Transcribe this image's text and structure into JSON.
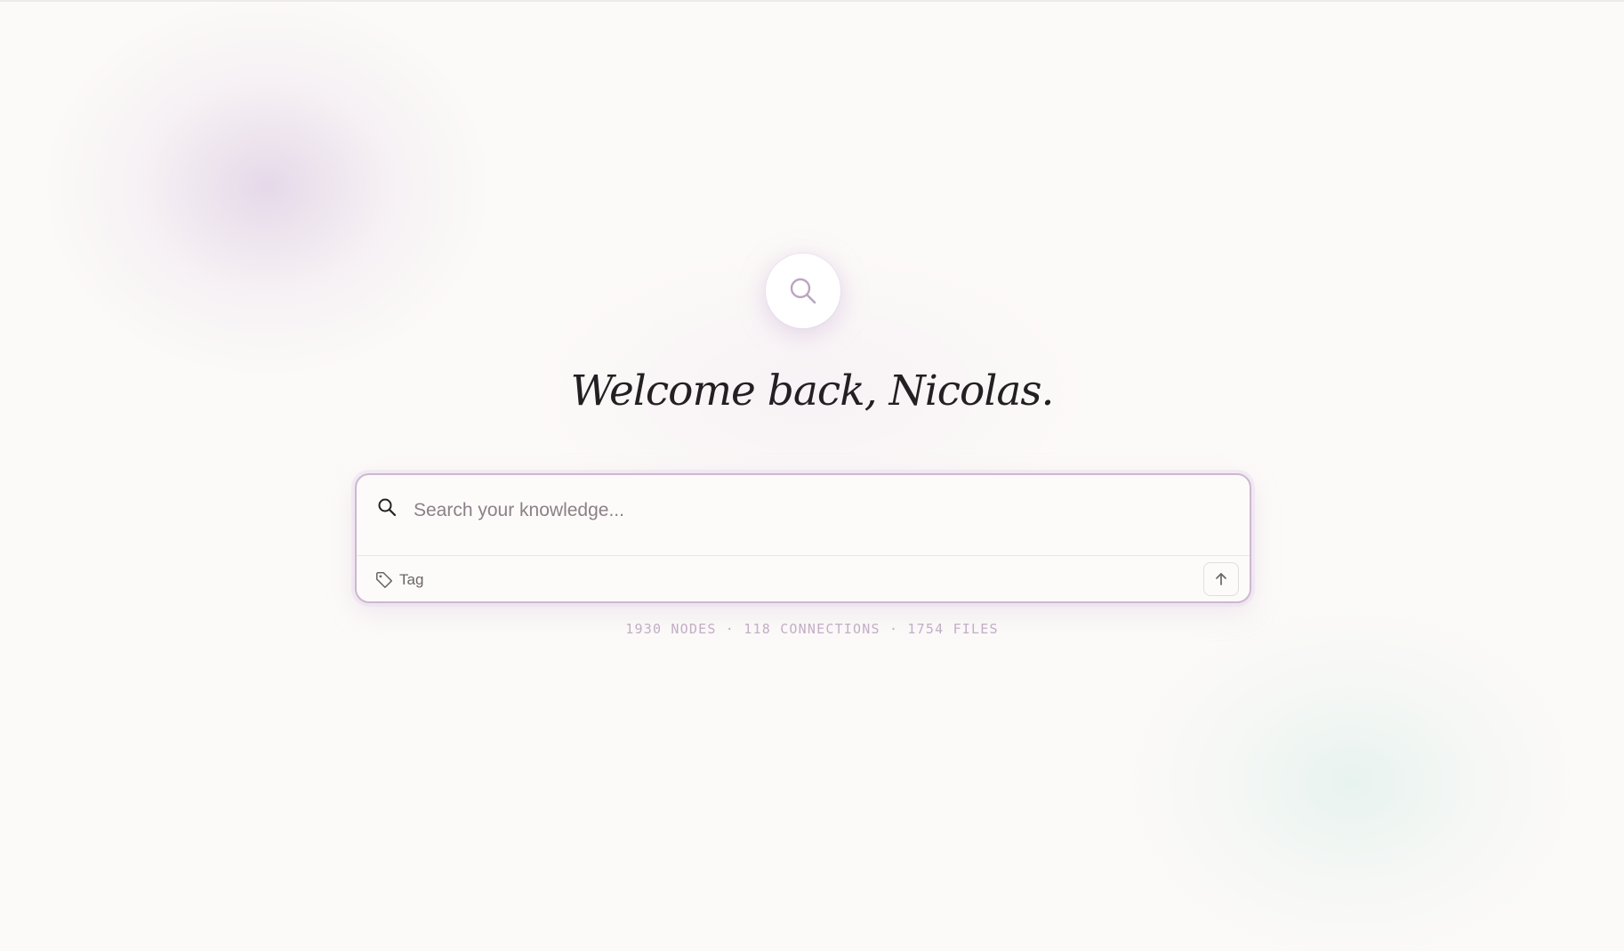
{
  "hero": {
    "icon": "search-icon",
    "title": "Welcome back, Nicolas."
  },
  "search": {
    "icon": "search-icon",
    "placeholder": "Search your knowledge...",
    "value": "",
    "tag_icon": "tag-icon",
    "tag_label": "Tag",
    "send_icon": "arrow-up-icon"
  },
  "stats": {
    "text": "1930 NODES · 118 CONNECTIONS · 1754 FILES"
  },
  "colors": {
    "background": "#fcfaf8",
    "accent": "#cdb7d2",
    "stats_text": "#c2aec6",
    "title_text": "#231f22"
  }
}
